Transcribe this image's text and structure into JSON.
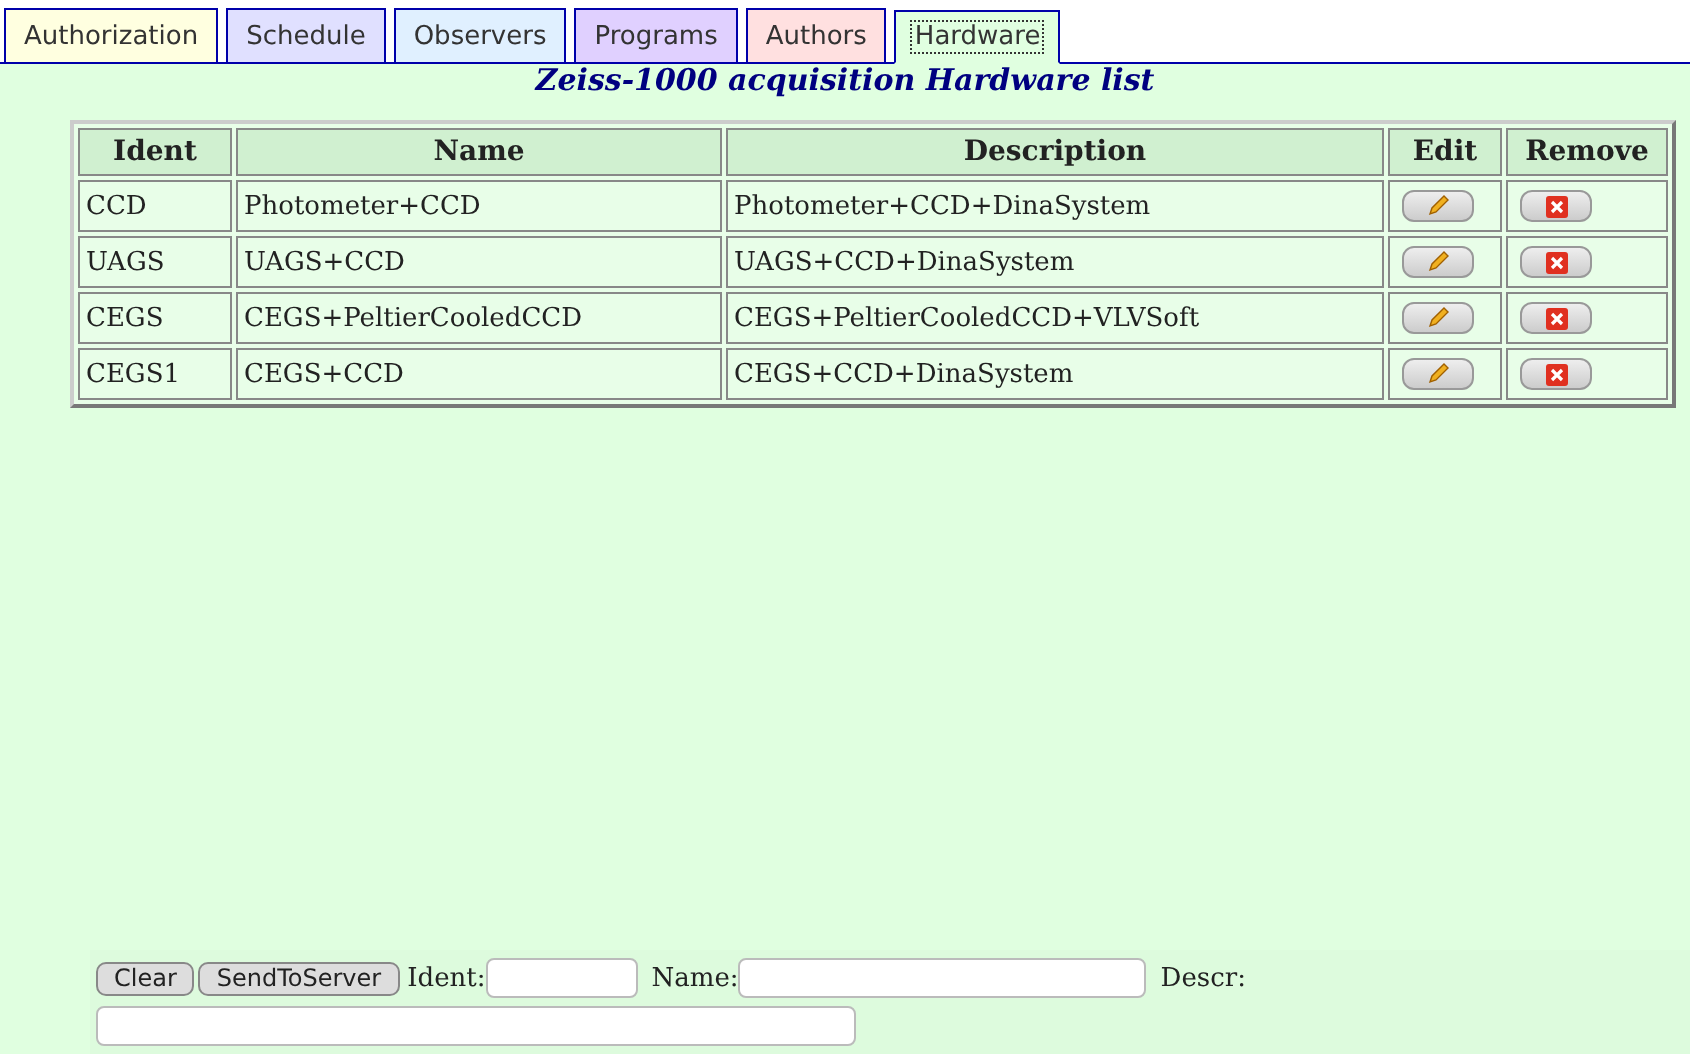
{
  "tabs": [
    {
      "label": "Authorization",
      "color": "#ffffe0",
      "selected": false
    },
    {
      "label": "Schedule",
      "color": "#e0e0ff",
      "selected": false
    },
    {
      "label": "Observers",
      "color": "#e0f0ff",
      "selected": false
    },
    {
      "label": "Programs",
      "color": "#e0d0ff",
      "selected": false
    },
    {
      "label": "Authors",
      "color": "#ffe0e0",
      "selected": false
    },
    {
      "label": "Hardware",
      "color": "#e0ffe0",
      "selected": true
    }
  ],
  "title": "Zeiss-1000 acquisition Hardware list",
  "table": {
    "columns": [
      "Ident",
      "Name",
      "Description",
      "Edit",
      "Remove"
    ],
    "rows": [
      {
        "ident": "CCD",
        "name": "Photometer+CCD",
        "description": "Photometer+CCD+DinaSystem"
      },
      {
        "ident": "UAGS",
        "name": "UAGS+CCD",
        "description": "UAGS+CCD+DinaSystem"
      },
      {
        "ident": "CEGS",
        "name": "CEGS+PeltierCooledCCD",
        "description": "CEGS+PeltierCooledCCD+VLVSoft"
      },
      {
        "ident": "CEGS1",
        "name": "CEGS+CCD",
        "description": "CEGS+CCD+DinaSystem"
      }
    ]
  },
  "form": {
    "buttons": [
      "Clear",
      "SendToServer"
    ],
    "fields": [
      {
        "label": "Ident:"
      },
      {
        "label": "Name:"
      },
      {
        "label": "Descr:"
      }
    ]
  }
}
